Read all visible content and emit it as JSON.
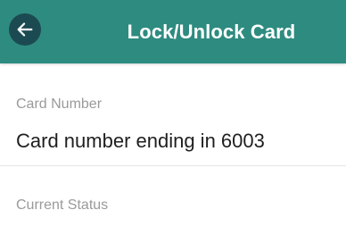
{
  "colors": {
    "app_bar": "#2e8b80",
    "back_button_bg": "#1c4a52",
    "label_text": "#9a9a9a",
    "value_text": "#1f1f1f",
    "divider": "#e4e4e4"
  },
  "header": {
    "back_icon": "arrow-left-icon",
    "title": "Lock/Unlock Card"
  },
  "card_number": {
    "label": "Card Number",
    "value": "Card number ending in 6003"
  },
  "current_status": {
    "label": "Current Status"
  }
}
